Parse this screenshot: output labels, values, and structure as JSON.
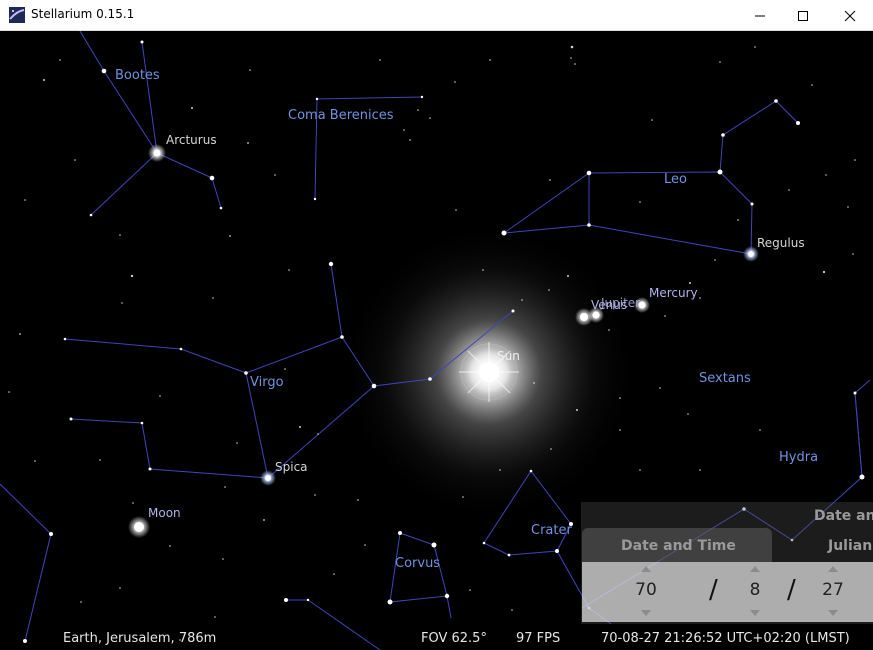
{
  "window": {
    "title": "Stellarium 0.15.1",
    "controls": [
      "minimize",
      "maximize",
      "close"
    ]
  },
  "sky": {
    "constellation_labels": [
      "Bootes",
      "Coma Berenices",
      "Leo",
      "Virgo",
      "Sextans",
      "Hydra",
      "Crater",
      "Corvus"
    ],
    "star_labels": [
      "Arcturus",
      "Regulus",
      "Spica"
    ],
    "planet_labels": [
      "Sun",
      "Venus",
      "Jupiter",
      "Mercury",
      "Moon"
    ],
    "colors": {
      "constellation_line": "#3f46b8",
      "constellation_label": "#6f93df",
      "star_label": "#d4d4d4",
      "planet_label": "#b3b3e8",
      "background": "#000000"
    }
  },
  "datetime_panel": {
    "tabs": [
      "Date and Time",
      "Julian"
    ],
    "header_partial": "Date an",
    "year": "70",
    "month": "8",
    "day": "27",
    "separator": "/"
  },
  "status": {
    "location": "Earth, Jerusalem, 786m",
    "fov": "FOV 62.5°",
    "fps": "97 FPS",
    "datetime": "70-08-27 21:26:52 UTC+02:20 (LMST)"
  }
}
